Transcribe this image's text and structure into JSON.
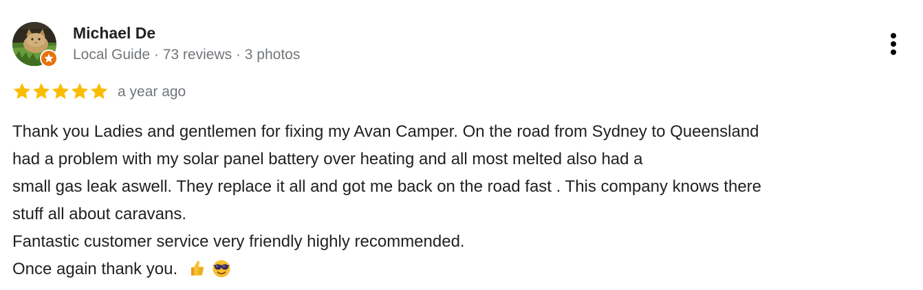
{
  "review": {
    "reviewer_name": "Michael De",
    "reviewer_meta": "Local Guide · 73 reviews · 3 photos",
    "rating": 5,
    "rating_max": 5,
    "date": "a year ago",
    "body_lines": [
      "Thank you Ladies and gentlemen for fixing my Avan Camper. On the road from Sydney to Queensland",
      "had a problem with my solar panel battery over heating and all most melted also had a",
      "small gas leak aswell. They replace it all and got me back on the road fast . This company knows there",
      "stuff all about caravans.",
      "Fantastic customer service very friendly highly recommended.",
      "Once again thank you."
    ],
    "emojis": [
      "thumbs-up-emoji",
      "sunglasses-face-emoji"
    ]
  },
  "icons": {
    "badge": "local-guide-star-icon",
    "menu": "more-options-vertical-dots-icon",
    "star": "star-icon"
  },
  "colors": {
    "star": "#fbbc04",
    "badge": "#e8710a",
    "name_text": "#202124",
    "meta_text": "#70757a",
    "body_text": "#202124",
    "emoji_yellow": "#f7c02f"
  }
}
